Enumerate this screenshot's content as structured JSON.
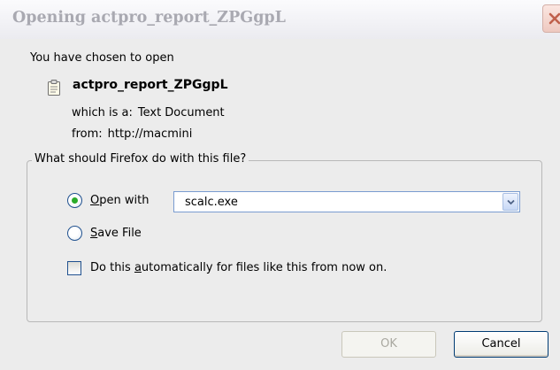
{
  "window": {
    "title": "Opening actpro_report_ZPGgpL"
  },
  "intro_text": "You have chosen to open",
  "file": {
    "name": "actpro_report_ZPGgpL",
    "type_label": "which is a:",
    "type_value": "Text Document",
    "from_label": "from:",
    "from_value": "http://macmini",
    "icon": "text-document-icon"
  },
  "action_group": {
    "legend": "What should Firefox do with this file?",
    "open_with": {
      "mnemonic": "O",
      "rest": "pen with",
      "selected": true
    },
    "application": {
      "value": "scalc.exe"
    },
    "save_file": {
      "mnemonic": "S",
      "rest": "ave File",
      "selected": false
    },
    "auto": {
      "prefix": "Do this ",
      "mnemonic": "a",
      "suffix": "utomatically for files like this from now on.",
      "checked": false
    }
  },
  "buttons": {
    "ok": "OK",
    "cancel": "Cancel"
  },
  "colors": {
    "radio_selected": "#2aab2a",
    "close_button": "#e8a89a",
    "focus_border": "#003c74"
  }
}
